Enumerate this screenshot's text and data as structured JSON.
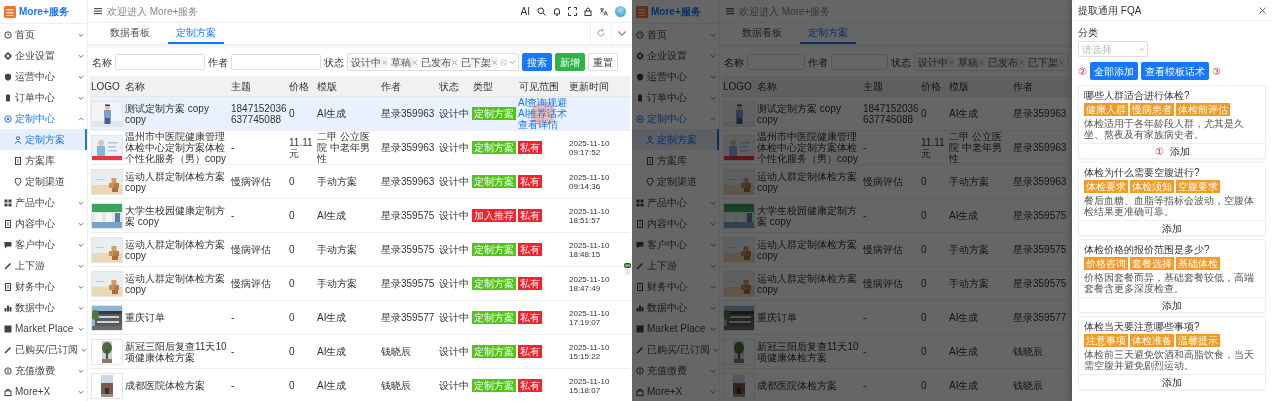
{
  "screens": [
    {
      "app_name": "More+服务",
      "welcome": "欢迎进入 More+服务",
      "header_tools": {
        "ai_label": "AI"
      },
      "sidebar": [
        {
          "label": "首页",
          "selected": false,
          "expanded": false
        },
        {
          "label": "企业设置",
          "selected": false,
          "expanded": false
        },
        {
          "label": "运营中心",
          "selected": false,
          "expanded": false
        },
        {
          "label": "订单中心",
          "selected": false,
          "expanded": false
        },
        {
          "label": "定制中心",
          "selected": false,
          "expanded": true,
          "children": [
            {
              "label": "定制方案",
              "selected": true
            },
            {
              "label": "方案库",
              "selected": false
            },
            {
              "label": "定制渠道",
              "selected": false
            }
          ]
        },
        {
          "label": "产品中心",
          "selected": false,
          "expanded": false
        },
        {
          "label": "内容中心",
          "selected": false,
          "expanded": false
        },
        {
          "label": "客户中心",
          "selected": false,
          "expanded": false
        },
        {
          "label": "上下游",
          "selected": false,
          "expanded": false
        },
        {
          "label": "财务中心",
          "selected": false,
          "expanded": false
        },
        {
          "label": "数据中心",
          "selected": false,
          "expanded": false
        },
        {
          "label": "Market Place",
          "selected": false,
          "expanded": false
        },
        {
          "label": "已购买/已订阅",
          "selected": false,
          "expanded": false
        },
        {
          "label": "充值缴费",
          "selected": false,
          "expanded": false
        },
        {
          "label": "More+X",
          "selected": false,
          "expanded": false
        }
      ],
      "tabs": [
        {
          "label": "数据看板",
          "selected": false
        },
        {
          "label": "定制方案",
          "selected": true
        }
      ],
      "filters": {
        "fields": [
          {
            "label": "名称"
          },
          {
            "label": "作者"
          }
        ],
        "status": {
          "label": "状态",
          "tags": [
            "设计中",
            "草稿",
            "已发布",
            "已下架"
          ]
        },
        "buttons": [
          {
            "label": "搜索",
            "kind": "primary"
          },
          {
            "label": "新增",
            "kind": "success"
          },
          {
            "label": "重置",
            "kind": "default"
          }
        ]
      },
      "table": {
        "columns": [
          {
            "label": "LOGO",
            "kind": "logo"
          },
          {
            "label": "名称",
            "kind": "name"
          },
          {
            "label": "主题",
            "kind": "theme"
          },
          {
            "label": "价格",
            "kind": "price"
          },
          {
            "label": "模版",
            "kind": "template"
          },
          {
            "label": "作者",
            "kind": "author"
          },
          {
            "label": "状态",
            "kind": "status"
          },
          {
            "label": "类型",
            "kind": "type"
          },
          {
            "label": "可见范围",
            "kind": "visibility"
          },
          {
            "label": "更新时间",
            "kind": "updated"
          }
        ],
        "rows": [
          {
            "selected": true,
            "name": "测试定制方案 copy copy",
            "theme": "1847152036637745088",
            "price": "0",
            "template": "AI生成",
            "author": "星录359963",
            "status": "设计中",
            "type": {
              "label": "定制方案",
              "color": "#52c41a"
            },
            "actions": [
              {
                "label": "AI查询规避",
                "highlighted": false
              },
              {
                "label": "AI推荐话术",
                "highlighted": true
              },
              {
                "label": "查看详情",
                "highlighted": false
              }
            ]
          },
          {
            "selected": false,
            "name": "温州市中医院健康管理体检中心定制方案体检个性化服务（男）copy",
            "theme": "-",
            "price": "11.11元",
            "template": "二甲 公立医院 中老年男性",
            "author": "星录359963",
            "status": "设计中",
            "type": {
              "label": "定制方案",
              "color": "#52c41a"
            },
            "visibility": {
              "label": "私有",
              "color": "#f5222d"
            },
            "updated": "2025-11-10 09:17:52"
          },
          {
            "selected": false,
            "name": "运动人群定制体检方案 copy",
            "theme": "慢病评估",
            "price": "0",
            "template": "手动方案",
            "author": "星录359963",
            "status": "设计中",
            "type": {
              "label": "定制方案",
              "color": "#52c41a"
            },
            "visibility": {
              "label": "私有",
              "color": "#f5222d"
            },
            "updated": "2025-11-10 09:14:36"
          },
          {
            "selected": false,
            "name": "大学生校园健康定制方案 copy",
            "theme": "-",
            "price": "0",
            "template": "AI生成",
            "author": "星录359575",
            "status": "设计中",
            "type": {
              "label": "加入推荐",
              "color": "#f5222d"
            },
            "visibility": {
              "label": "私有",
              "color": "#f5222d"
            },
            "updated": "2025-11-10 18:51:57"
          },
          {
            "selected": false,
            "name": "运动人群定制体检方案 copy",
            "theme": "慢病评估",
            "price": "0",
            "template": "手动方案",
            "author": "星录359575",
            "status": "设计中",
            "type": {
              "label": "定制方案",
              "color": "#52c41a"
            },
            "visibility": {
              "label": "私有",
              "color": "#f5222d"
            },
            "updated": "2025-11-10 18:48:15"
          },
          {
            "selected": false,
            "name": "运动人群定制体检方案 copy",
            "theme": "慢病评估",
            "price": "0",
            "template": "手动方案",
            "author": "星录359575",
            "status": "设计中",
            "type": {
              "label": "定制方案",
              "color": "#52c41a"
            },
            "visibility": {
              "label": "私有",
              "color": "#f5222d"
            },
            "updated": "2025-11-10 18:47:49"
          },
          {
            "selected": false,
            "name": "重庆订单",
            "theme": "-",
            "price": "0",
            "template": "AI生成",
            "author": "星录359577",
            "status": "设计中",
            "type": {
              "label": "定制方案",
              "color": "#52c41a"
            },
            "visibility": {
              "label": "私有",
              "color": "#f5222d"
            },
            "updated": "2025-11-10 17:19:07"
          },
          {
            "selected": false,
            "name": "新冠三阳后复查11天10项健康体检方案",
            "theme": "-",
            "price": "0",
            "template": "AI生成",
            "author": "钱晓辰",
            "status": "设计中",
            "type": {
              "label": "定制方案",
              "color": "#52c41a"
            },
            "visibility": {
              "label": "私有",
              "color": "#f5222d"
            },
            "updated": "2025-11-10 15:15:22"
          },
          {
            "selected": false,
            "name": "成都医院体检方案",
            "theme": "-",
            "price": "0",
            "template": "AI生成",
            "author": "钱晓辰",
            "status": "设计中",
            "type": {
              "label": "定制方案",
              "color": "#52c41a"
            },
            "visibility": {
              "label": "私有",
              "color": "#f5222d"
            },
            "updated": "2025-11-10 15:18:07"
          }
        ]
      }
    },
    {
      "app_name": "More+服务",
      "welcome": "欢迎进入 More+服务",
      "sidebar": [
        {
          "label": "首页",
          "selected": false,
          "expanded": false
        },
        {
          "label": "企业设置",
          "selected": false,
          "expanded": false
        },
        {
          "label": "运营中心",
          "selected": false,
          "expanded": false
        },
        {
          "label": "订单中心",
          "selected": false,
          "expanded": false
        },
        {
          "label": "定制中心",
          "selected": false,
          "expanded": true,
          "children": [
            {
              "label": "定制方案",
              "selected": true
            },
            {
              "label": "方案库",
              "selected": false
            },
            {
              "label": "定制渠道",
              "selected": false
            }
          ]
        },
        {
          "label": "产品中心",
          "selected": false,
          "expanded": false
        },
        {
          "label": "内容中心",
          "selected": false,
          "expanded": false
        },
        {
          "label": "客户中心",
          "selected": false,
          "expanded": false
        },
        {
          "label": "上下游",
          "selected": false,
          "expanded": false
        },
        {
          "label": "财务中心",
          "selected": false,
          "expanded": false
        },
        {
          "label": "数据中心",
          "selected": false,
          "expanded": false
        },
        {
          "label": "Market Place",
          "selected": false,
          "expanded": false
        },
        {
          "label": "已购买/已订阅",
          "selected": false,
          "expanded": false
        },
        {
          "label": "充值缴费",
          "selected": false,
          "expanded": false
        },
        {
          "label": "More+X",
          "selected": false,
          "expanded": false
        }
      ],
      "tabs": [
        {
          "label": "数据看板",
          "selected": false
        },
        {
          "label": "定制方案",
          "selected": true
        }
      ],
      "filters": {
        "fields": [
          {
            "label": "名称"
          },
          {
            "label": "作者"
          }
        ],
        "status": {
          "label": "状态",
          "tags": [
            "设计中",
            "草稿",
            "已发布",
            "已下架"
          ]
        }
      },
      "table": {
        "columns": [
          {
            "label": "LOGO",
            "kind": "logo"
          },
          {
            "label": "名称",
            "kind": "name"
          },
          {
            "label": "主题",
            "kind": "theme"
          },
          {
            "label": "价格",
            "kind": "price"
          },
          {
            "label": "模版",
            "kind": "template"
          },
          {
            "label": "作者",
            "kind": "author"
          }
        ],
        "rows": [
          {
            "name": "测试定制方案 copy copy",
            "theme": "1847152036637745088",
            "price": "0",
            "template": "AI生成",
            "author": "星录359963"
          },
          {
            "name": "温州市中医院健康管理体检中心定制方案体检个性化服务（男）copy",
            "theme": "-",
            "price": "11.11元",
            "template": "二甲 公立医院 中老年男性",
            "author": "星录359963"
          },
          {
            "name": "运动人群定制体检方案 copy",
            "theme": "慢病评估",
            "price": "0",
            "template": "手动方案",
            "author": "星录359963"
          },
          {
            "name": "大学生校园健康定制方案 copy",
            "theme": "-",
            "price": "0",
            "template": "AI生成",
            "author": "星录359575"
          },
          {
            "name": "运动人群定制体检方案 copy",
            "theme": "慢病评估",
            "price": "0",
            "template": "手动方案",
            "author": "星录359575"
          },
          {
            "name": "运动人群定制体检方案 copy",
            "theme": "慢病评估",
            "price": "0",
            "template": "手动方案",
            "author": "星录359575"
          },
          {
            "name": "重庆订单",
            "theme": "-",
            "price": "0",
            "template": "AI生成",
            "author": "星录359577"
          },
          {
            "name": "新冠三阳后复查11天10项健康体检方案",
            "theme": "-",
            "price": "0",
            "template": "AI生成",
            "author": "钱晓辰"
          },
          {
            "name": "成都医院体检方案",
            "theme": "-",
            "price": "0",
            "template": "AI生成",
            "author": "钱晓辰"
          }
        ]
      },
      "drawer": {
        "title": "提取通用 FQA",
        "category": {
          "label": "分类",
          "placeholder": "请选择"
        },
        "toolbar": [
          {
            "kind": "marker",
            "text": "②"
          },
          {
            "kind": "button",
            "label": "全部添加"
          },
          {
            "kind": "button",
            "label": "查看模板话术"
          },
          {
            "kind": "marker",
            "text": "③"
          }
        ],
        "cards": [
          {
            "question": "哪些人群适合进行体检?",
            "tags": [
              "健康人群",
              "慢病患者",
              "体检前评估"
            ],
            "answer": "体检适用于各年龄段人群，尤其是久坐、熬夜及有家族病史者。",
            "add_label": "添加",
            "marker": "①"
          },
          {
            "question": "体检为什么需要空腹进行?",
            "tags": [
              "体检要求",
              "体检须知",
              "空腹要求"
            ],
            "answer": "餐后血糖、血脂等指标会波动，空腹体检结果更准确可靠。",
            "add_label": "添加"
          },
          {
            "question": "体检价格的报价范围是多少?",
            "tags": [
              "价格咨询",
              "套餐选择",
              "基础体检"
            ],
            "answer": "价格因套餐而异，基础套餐较低，高端套餐含更多深度检查。",
            "add_label": "添加"
          },
          {
            "question": "体检当天要注意哪些事项?",
            "tags": [
              "注意事项",
              "体检准备",
              "温馨提示"
            ],
            "answer": "体检前三天避免饮酒和高脂饮食，当天需空腹并避免剧烈运动。",
            "add_label": "添加"
          }
        ]
      }
    }
  ]
}
